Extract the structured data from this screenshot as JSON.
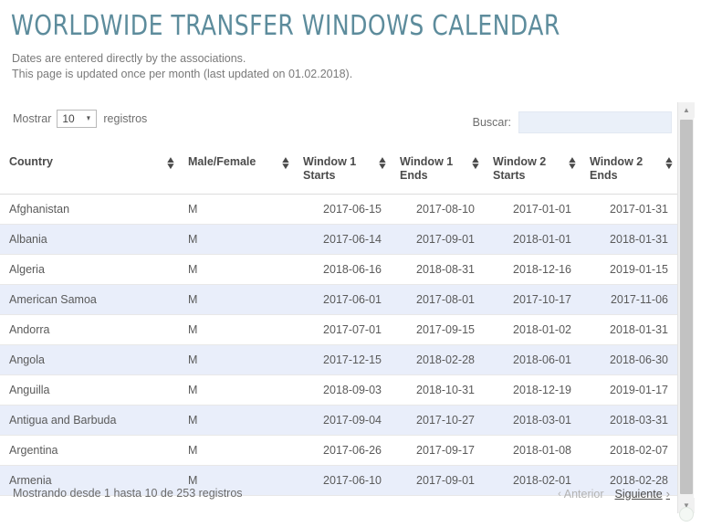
{
  "header": {
    "title": "Worldwide Transfer Windows Calendar",
    "subtitle_line1": "Dates are entered directly by the associations.",
    "subtitle_line2": "This page is updated once per month (last updated on 01.02.2018).",
    "title_color": "#5d8c9c"
  },
  "controls": {
    "length_label_before": "Mostrar",
    "length_value": "10",
    "length_caret": "▼",
    "length_label_after": "registros",
    "filter_label": "Buscar:",
    "filter_value": "",
    "filter_placeholder": ""
  },
  "table": {
    "columns": [
      {
        "label": "Country",
        "sortable": true,
        "align": "left"
      },
      {
        "label": "Male/Female",
        "sortable": true,
        "align": "left"
      },
      {
        "label": "Window 1 Starts",
        "line1": "Window 1",
        "line2": "Starts",
        "sortable": true,
        "align": "right"
      },
      {
        "label": "Window 1 Ends",
        "line1": "Window 1",
        "line2": "Ends",
        "sortable": true,
        "align": "right"
      },
      {
        "label": "Window 2 Starts",
        "line1": "Window 2",
        "line2": "Starts",
        "sortable": true,
        "align": "right"
      },
      {
        "label": "Window 2 Ends",
        "line1": "Window 2",
        "line2": "Ends",
        "sortable": true,
        "align": "right"
      }
    ],
    "sort_glyph_up": "▲",
    "sort_glyph_down": "▼",
    "rows": [
      {
        "country": "Afghanistan",
        "gender": "M",
        "w1s": "2017-06-15",
        "w1e": "2017-08-10",
        "w2s": "2017-01-01",
        "w2e": "2017-01-31"
      },
      {
        "country": "Albania",
        "gender": "M",
        "w1s": "2017-06-14",
        "w1e": "2017-09-01",
        "w2s": "2018-01-01",
        "w2e": "2018-01-31"
      },
      {
        "country": "Algeria",
        "gender": "M",
        "w1s": "2018-06-16",
        "w1e": "2018-08-31",
        "w2s": "2018-12-16",
        "w2e": "2019-01-15"
      },
      {
        "country": "American Samoa",
        "gender": "M",
        "w1s": "2017-06-01",
        "w1e": "2017-08-01",
        "w2s": "2017-10-17",
        "w2e": "2017-11-06"
      },
      {
        "country": "Andorra",
        "gender": "M",
        "w1s": "2017-07-01",
        "w1e": "2017-09-15",
        "w2s": "2018-01-02",
        "w2e": "2018-01-31"
      },
      {
        "country": "Angola",
        "gender": "M",
        "w1s": "2017-12-15",
        "w1e": "2018-02-28",
        "w2s": "2018-06-01",
        "w2e": "2018-06-30"
      },
      {
        "country": "Anguilla",
        "gender": "M",
        "w1s": "2018-09-03",
        "w1e": "2018-10-31",
        "w2s": "2018-12-19",
        "w2e": "2019-01-17"
      },
      {
        "country": "Antigua and Barbuda",
        "gender": "M",
        "w1s": "2017-09-04",
        "w1e": "2017-10-27",
        "w2s": "2018-03-01",
        "w2e": "2018-03-31"
      },
      {
        "country": "Argentina",
        "gender": "M",
        "w1s": "2017-06-26",
        "w1e": "2017-09-17",
        "w2s": "2018-01-08",
        "w2e": "2018-02-07"
      },
      {
        "country": "Armenia",
        "gender": "M",
        "w1s": "2017-06-10",
        "w1e": "2017-09-01",
        "w2s": "2018-02-01",
        "w2e": "2018-02-28"
      }
    ]
  },
  "footer": {
    "info": "Mostrando desde 1 hasta 10 de 253 registros",
    "prev_label": "Anterior",
    "prev_chevron": "‹",
    "next_label": "Siguiente",
    "next_chevron": "›"
  },
  "scrollbar": {
    "up_glyph": "▲",
    "down_glyph": "▼"
  }
}
